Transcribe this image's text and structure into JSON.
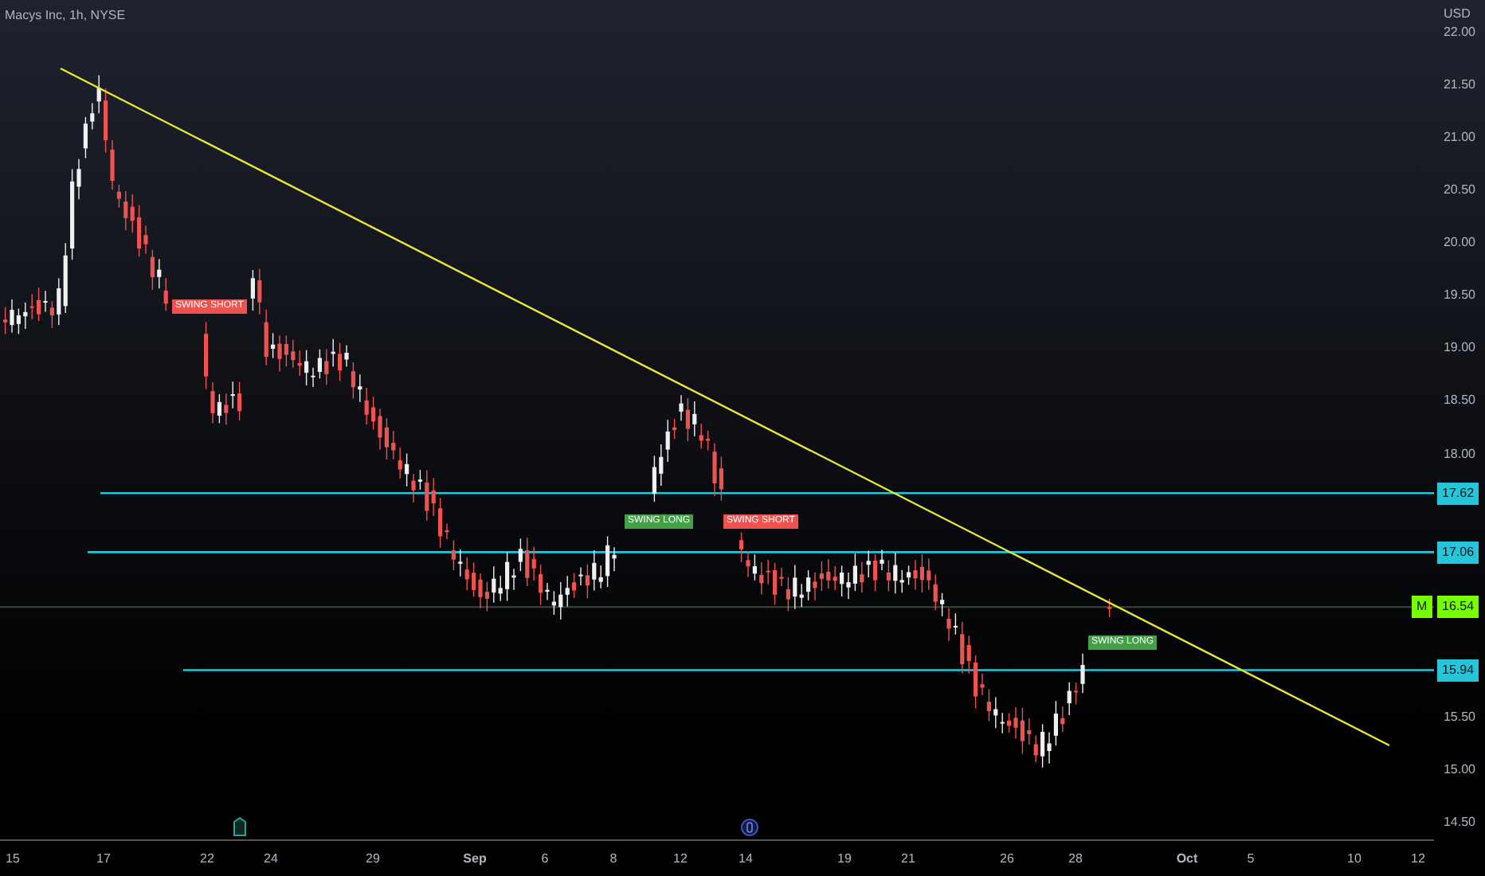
{
  "header": {
    "symbol": "Macys Inc, 1h, NYSE",
    "currency": "USD"
  },
  "price_axis": {
    "ticks": [
      "22.00",
      "21.50",
      "21.00",
      "20.50",
      "20.00",
      "19.50",
      "19.00",
      "18.50",
      "18.00",
      "15.50",
      "15.00",
      "14.50"
    ]
  },
  "time_axis": {
    "ticks": [
      "15",
      "17",
      "22",
      "24",
      "29",
      "Sep",
      "6",
      "8",
      "12",
      "14",
      "19",
      "21",
      "26",
      "28",
      "Oct",
      "5",
      "10",
      "12"
    ]
  },
  "levels": [
    {
      "price": "17.62"
    },
    {
      "price": "17.06"
    },
    {
      "price": "15.94"
    }
  ],
  "current_price": {
    "marker": "M",
    "price": "16.54"
  },
  "signals": [
    {
      "text": "SWING SHORT",
      "kind": "short"
    },
    {
      "text": "SWING LONG",
      "kind": "long"
    },
    {
      "text": "SWING SHORT",
      "kind": "short"
    },
    {
      "text": "SWING LONG",
      "kind": "long"
    }
  ],
  "events": [
    {
      "kind": "earnings"
    },
    {
      "kind": "dividend"
    }
  ]
}
